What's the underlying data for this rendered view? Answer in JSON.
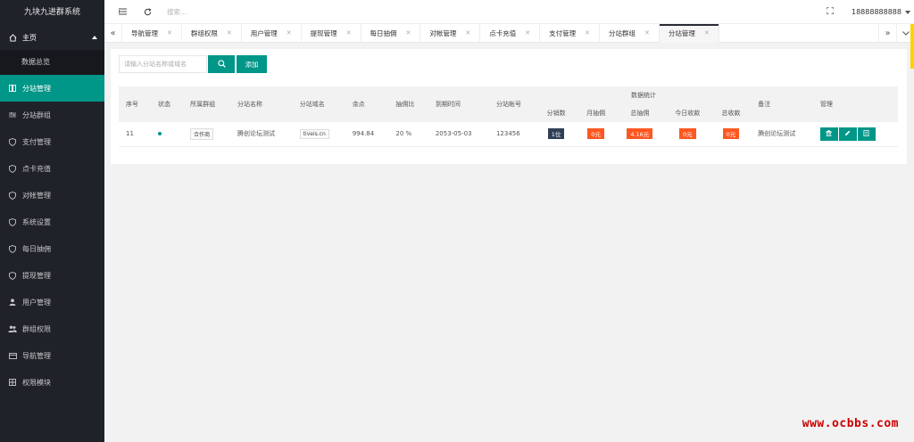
{
  "app": {
    "title": "九块九进群系统"
  },
  "sidebar": {
    "main_label": "主页",
    "sub_item": "数据总览",
    "items": [
      {
        "label": "分站管理",
        "icon": "grid-icon",
        "active": true
      },
      {
        "label": "分站群组",
        "icon": "sliders-icon"
      },
      {
        "label": "支付管理",
        "icon": "shield-icon"
      },
      {
        "label": "点卡充值",
        "icon": "shield-icon"
      },
      {
        "label": "对帐管理",
        "icon": "shield-icon"
      },
      {
        "label": "系统设置",
        "icon": "shield-icon"
      },
      {
        "label": "每日抽佣",
        "icon": "shield-icon"
      },
      {
        "label": "提现管理",
        "icon": "shield-icon"
      },
      {
        "label": "用户管理",
        "icon": "user-icon"
      },
      {
        "label": "群组权限",
        "icon": "users-icon"
      },
      {
        "label": "导航管理",
        "icon": "nav-icon"
      },
      {
        "label": "权限模块",
        "icon": "modules-icon"
      }
    ]
  },
  "topbar": {
    "search_placeholder": "搜索...",
    "username": "18888888888"
  },
  "tabs": [
    {
      "label": "导航管理"
    },
    {
      "label": "群组权限"
    },
    {
      "label": "用户管理"
    },
    {
      "label": "提现管理"
    },
    {
      "label": "每日抽佣"
    },
    {
      "label": "对帐管理"
    },
    {
      "label": "点卡充值"
    },
    {
      "label": "支付管理"
    },
    {
      "label": "分站群组"
    },
    {
      "label": "分站管理",
      "active": true
    }
  ],
  "toolbar": {
    "search_placeholder": "请输入分站名称或域名",
    "add_label": "添加"
  },
  "table": {
    "headers": {
      "index": "序号",
      "status": "状态",
      "group": "所属群组",
      "name": "分站名称",
      "domain": "分站域名",
      "balance": "余点",
      "ratio": "抽佣比",
      "expire": "到期时间",
      "account": "分站帐号",
      "stats": "数据统计",
      "sales": "分销数",
      "month_comm": "月抽佣",
      "total_comm": "总抽佣",
      "today_income": "今日收款",
      "total_income": "总收款",
      "remark": "备注",
      "manage": "管理"
    },
    "rows": [
      {
        "index": "11",
        "group": "合作商",
        "name": "腾创论坛测试",
        "domain": "tiveis.cn",
        "balance": "994.84",
        "ratio": "20 %",
        "expire": "2053-05-03",
        "account": "123456",
        "sales": "1位",
        "month_comm": "0元",
        "total_comm": "4.16元",
        "today_income": "0元",
        "total_income": "0元",
        "remark": "腾创论坛测试"
      }
    ]
  },
  "watermark": "www.ocbbs.com",
  "colors": {
    "accent": "#009688",
    "sidebar": "#20222a",
    "danger": "#ff5722",
    "dark_pill": "#2f4056"
  }
}
